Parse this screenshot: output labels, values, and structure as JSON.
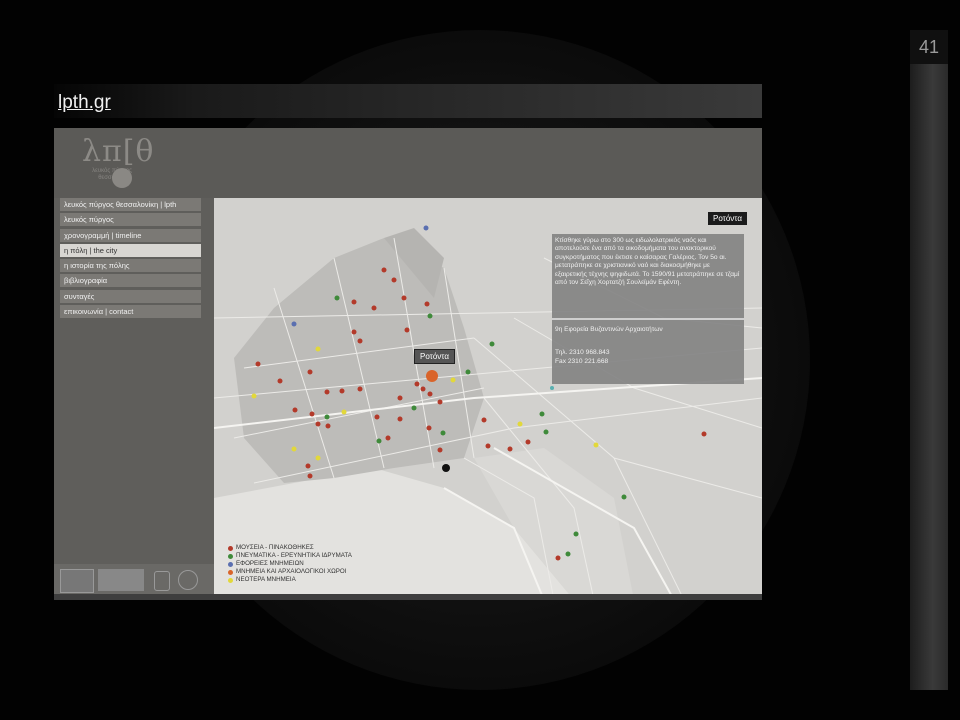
{
  "slide": {
    "number": "41",
    "title_link": "lpth.gr"
  },
  "site": {
    "logo_text": "λπ[θ",
    "logo_sub": "λευκός πύργος θεσσαλονίκη",
    "menu": [
      {
        "label": "λευκός πύργος θεσσαλονίκη | lpth"
      },
      {
        "label": "λευκός πύργος"
      },
      {
        "label": "χρονογραμμή | timeline"
      },
      {
        "label": "η πόλη | the city"
      },
      {
        "label": "η ιστορία της πόλης"
      },
      {
        "label": "βιβλιογραφία"
      },
      {
        "label": "συνταγές"
      },
      {
        "label": "επικοινωνία | contact"
      }
    ],
    "active_menu_index": 3
  },
  "map": {
    "tooltip": "Ροτόντα",
    "info_title": "Ροτόντα",
    "info_description": "Κτίσθηκε γύρω στο 300 ως ειδωλολατρικός ναός και αποτελούσε ένα από τα οικοδομήματα του ανακτορικού συγκροτήματος που έκτισε ο καίσαρας Γαλέριος. Τον 5ο αι. μετατράπηκε σε χριστιανικό ναό και διακοσμήθηκε με εξαιρετικής τέχνης ψηφιδωτά. Το 1590/91 μετατράπηκε σε τζαμί από τον Σεΐχη Χορτατζή Σουλεϊμάν Εφέντη.",
    "info_org": "9η Εφορεία Βυζαντινών Αρχαιοτήτων",
    "info_tel": "Τηλ. 2310 968.843",
    "info_fax": "Fax 2310 221.668",
    "legend": [
      {
        "label": "ΜΟΥΣΕΙΑ - ΠΙΝΑΚΟΘΗΚΕΣ",
        "color": "#b33a2a"
      },
      {
        "label": "ΠΝΕΥΜΑΤΙΚΑ - ΕΡΕΥΝΗΤΙΚΑ ΙΔΡΥΜΑΤΑ",
        "color": "#3f8a3a"
      },
      {
        "label": "ΕΦΟΡΕΙΕΣ ΜΝΗΜΕΙΩΝ",
        "color": "#5a6fb0"
      },
      {
        "label": "ΜΝΗΜΕΙΑ ΚΑΙ ΑΡΧΑΙΟΛΟΓΙΚΟΙ ΧΩΡΟΙ",
        "color": "#d9642a"
      },
      {
        "label": "ΝΕΟΤΕΡΑ ΜΝΗΜΕΙΑ",
        "color": "#e2d83a"
      }
    ],
    "colors": {
      "museum": "#b33a2a",
      "institute": "#3f8a3a",
      "ephorate": "#5a6fb0",
      "monument": "#d9642a",
      "modern": "#e2d83a"
    }
  }
}
